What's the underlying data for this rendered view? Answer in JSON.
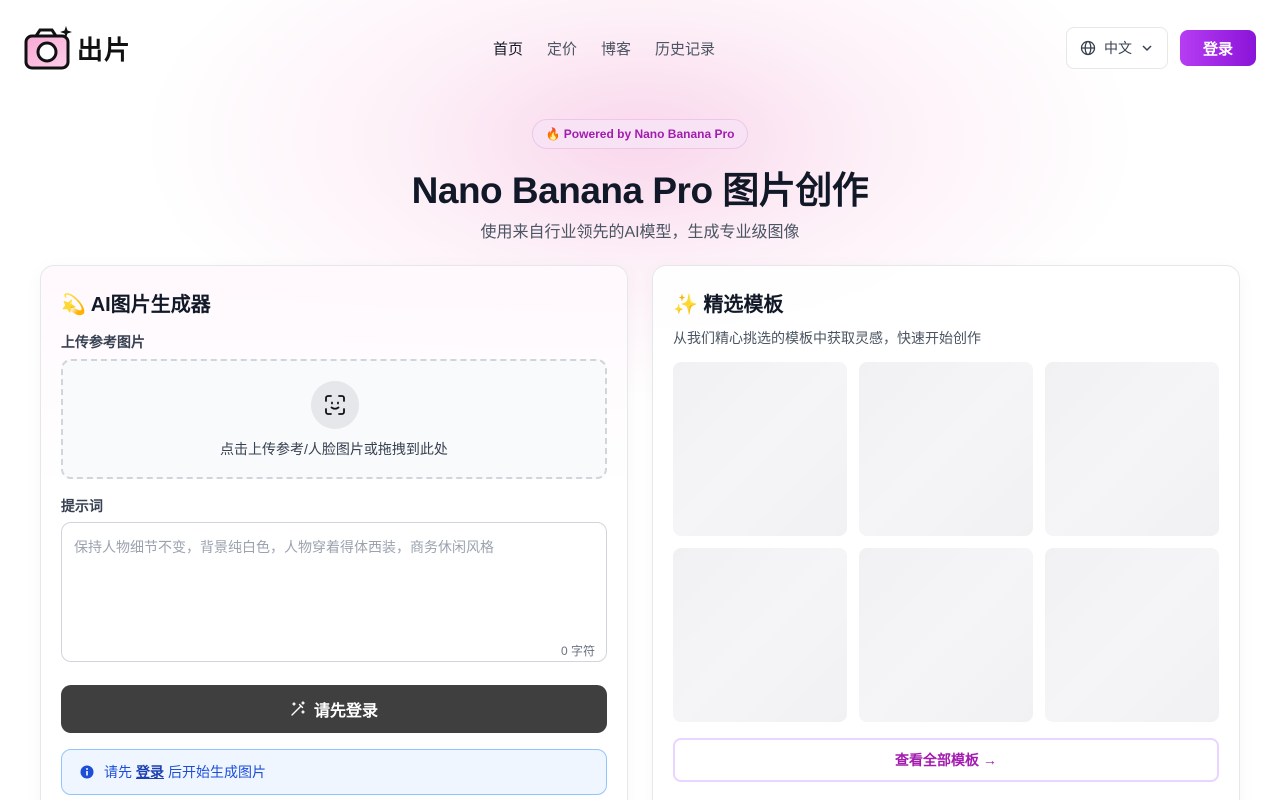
{
  "brand": {
    "name": "出片"
  },
  "nav": [
    {
      "label": "首页",
      "active": true
    },
    {
      "label": "定价",
      "active": false
    },
    {
      "label": "博客",
      "active": false
    },
    {
      "label": "历史记录",
      "active": false
    }
  ],
  "header": {
    "language": "中文",
    "login": "登录"
  },
  "hero": {
    "badge": "🔥 Powered by Nano Banana Pro",
    "title": "Nano Banana Pro 图片创作",
    "subtitle": "使用来自行业领先的AI模型，生成专业级图像"
  },
  "generator": {
    "title": "💫 AI图片生成器",
    "upload_label": "上传参考图片",
    "upload_hint": "点击上传参考/人脸图片或拖拽到此处",
    "prompt_label": "提示词",
    "prompt_placeholder": "保持人物细节不变，背景纯白色，人物穿着得体西装，商务休闲风格",
    "prompt_value": "",
    "char_count": "0 字符",
    "generate_button": "请先登录",
    "notice_prefix": "请先",
    "notice_link": "登录",
    "notice_suffix": "后开始生成图片"
  },
  "templates": {
    "title": "✨ 精选模板",
    "description": "从我们精心挑选的模板中获取灵感，快速开始创作",
    "view_all": "查看全部模板 →"
  },
  "colors": {
    "accent": "#9b2bea",
    "badge_text": "#a21caf",
    "notice_blue": "#1d4ed8"
  }
}
